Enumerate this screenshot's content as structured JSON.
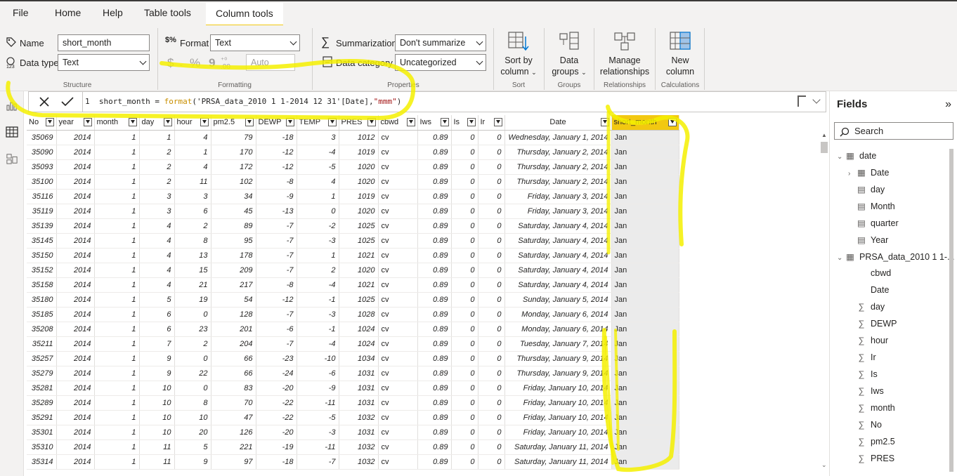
{
  "menu": {
    "file": "File",
    "home": "Home",
    "help": "Help",
    "table_tools": "Table tools",
    "column_tools": "Column tools"
  },
  "ribbon": {
    "name_label": "Name",
    "name_value": "short_month",
    "datatype_label": "Data type",
    "datatype_value": "Text",
    "structure_label": "Structure",
    "format_label": "Format",
    "format_value": "Text",
    "currency_symbol": "$",
    "percent_symbol": "%",
    "comma_symbol": "9",
    "decimal_value": "Auto",
    "formatting_label": "Formatting",
    "summarization_label": "Summarization",
    "summarization_value": "Don't summarize",
    "datacategory_label": "Data category",
    "datacategory_value": "Uncategorized",
    "properties_label": "Properties",
    "sortby_line1": "Sort by",
    "sortby_line2": "column",
    "sort_label": "Sort",
    "datagroups_line1": "Data",
    "datagroups_line2": "groups",
    "groups_label": "Groups",
    "manage_line1": "Manage",
    "manage_line2": "relationships",
    "relationships_label": "Relationships",
    "newcol_line1": "New",
    "newcol_line2": "column",
    "calculations_label": "Calculations"
  },
  "formula": {
    "line_no": "1",
    "prefix": "short_month = ",
    "fn": "format",
    "arg": "('PRSA_data_2010 1 1-2014 12 31'[Date],",
    "str": "\"mmm\"",
    "suffix": ")"
  },
  "table": {
    "headers": [
      "No",
      "year",
      "month",
      "day",
      "hour",
      "pm2.5",
      "DEWP",
      "TEMP",
      "PRES",
      "cbwd",
      "Iws",
      "Is",
      "Ir",
      "Date",
      "short_month"
    ],
    "rows": [
      [
        "35069",
        "2014",
        "1",
        "1",
        "4",
        "79",
        "-18",
        "3",
        "1012",
        "cv",
        "0.89",
        "0",
        "0",
        "Wednesday, January 1, 2014",
        "Jan"
      ],
      [
        "35090",
        "2014",
        "1",
        "2",
        "1",
        "170",
        "-12",
        "-4",
        "1019",
        "cv",
        "0.89",
        "0",
        "0",
        "Thursday, January 2, 2014",
        "Jan"
      ],
      [
        "35093",
        "2014",
        "1",
        "2",
        "4",
        "172",
        "-12",
        "-5",
        "1020",
        "cv",
        "0.89",
        "0",
        "0",
        "Thursday, January 2, 2014",
        "Jan"
      ],
      [
        "35100",
        "2014",
        "1",
        "2",
        "11",
        "102",
        "-8",
        "4",
        "1020",
        "cv",
        "0.89",
        "0",
        "0",
        "Thursday, January 2, 2014",
        "Jan"
      ],
      [
        "35116",
        "2014",
        "1",
        "3",
        "3",
        "34",
        "-9",
        "1",
        "1019",
        "cv",
        "0.89",
        "0",
        "0",
        "Friday, January 3, 2014",
        "Jan"
      ],
      [
        "35119",
        "2014",
        "1",
        "3",
        "6",
        "45",
        "-13",
        "0",
        "1020",
        "cv",
        "0.89",
        "0",
        "0",
        "Friday, January 3, 2014",
        "Jan"
      ],
      [
        "35139",
        "2014",
        "1",
        "4",
        "2",
        "89",
        "-7",
        "-2",
        "1025",
        "cv",
        "0.89",
        "0",
        "0",
        "Saturday, January 4, 2014",
        "Jan"
      ],
      [
        "35145",
        "2014",
        "1",
        "4",
        "8",
        "95",
        "-7",
        "-3",
        "1025",
        "cv",
        "0.89",
        "0",
        "0",
        "Saturday, January 4, 2014",
        "Jan"
      ],
      [
        "35150",
        "2014",
        "1",
        "4",
        "13",
        "178",
        "-7",
        "1",
        "1021",
        "cv",
        "0.89",
        "0",
        "0",
        "Saturday, January 4, 2014",
        "Jan"
      ],
      [
        "35152",
        "2014",
        "1",
        "4",
        "15",
        "209",
        "-7",
        "2",
        "1020",
        "cv",
        "0.89",
        "0",
        "0",
        "Saturday, January 4, 2014",
        "Jan"
      ],
      [
        "35158",
        "2014",
        "1",
        "4",
        "21",
        "217",
        "-8",
        "-4",
        "1021",
        "cv",
        "0.89",
        "0",
        "0",
        "Saturday, January 4, 2014",
        "Jan"
      ],
      [
        "35180",
        "2014",
        "1",
        "5",
        "19",
        "54",
        "-12",
        "-1",
        "1025",
        "cv",
        "0.89",
        "0",
        "0",
        "Sunday, January 5, 2014",
        "Jan"
      ],
      [
        "35185",
        "2014",
        "1",
        "6",
        "0",
        "128",
        "-7",
        "-3",
        "1028",
        "cv",
        "0.89",
        "0",
        "0",
        "Monday, January 6, 2014",
        "Jan"
      ],
      [
        "35208",
        "2014",
        "1",
        "6",
        "23",
        "201",
        "-6",
        "-1",
        "1024",
        "cv",
        "0.89",
        "0",
        "0",
        "Monday, January 6, 2014",
        "Jan"
      ],
      [
        "35211",
        "2014",
        "1",
        "7",
        "2",
        "204",
        "-7",
        "-4",
        "1024",
        "cv",
        "0.89",
        "0",
        "0",
        "Tuesday, January 7, 2014",
        "Jan"
      ],
      [
        "35257",
        "2014",
        "1",
        "9",
        "0",
        "66",
        "-23",
        "-10",
        "1034",
        "cv",
        "0.89",
        "0",
        "0",
        "Thursday, January 9, 2014",
        "Jan"
      ],
      [
        "35279",
        "2014",
        "1",
        "9",
        "22",
        "66",
        "-24",
        "-6",
        "1031",
        "cv",
        "0.89",
        "0",
        "0",
        "Thursday, January 9, 2014",
        "Jan"
      ],
      [
        "35281",
        "2014",
        "1",
        "10",
        "0",
        "83",
        "-20",
        "-9",
        "1031",
        "cv",
        "0.89",
        "0",
        "0",
        "Friday, January 10, 2014",
        "Jan"
      ],
      [
        "35289",
        "2014",
        "1",
        "10",
        "8",
        "70",
        "-22",
        "-11",
        "1031",
        "cv",
        "0.89",
        "0",
        "0",
        "Friday, January 10, 2014",
        "Jan"
      ],
      [
        "35291",
        "2014",
        "1",
        "10",
        "10",
        "47",
        "-22",
        "-5",
        "1032",
        "cv",
        "0.89",
        "0",
        "0",
        "Friday, January 10, 2014",
        "Jan"
      ],
      [
        "35301",
        "2014",
        "1",
        "10",
        "20",
        "126",
        "-20",
        "-3",
        "1031",
        "cv",
        "0.89",
        "0",
        "0",
        "Friday, January 10, 2014",
        "Jan"
      ],
      [
        "35310",
        "2014",
        "1",
        "11",
        "5",
        "221",
        "-19",
        "-11",
        "1032",
        "cv",
        "0.89",
        "0",
        "0",
        "Saturday, January 11, 2014",
        "Jan"
      ],
      [
        "35314",
        "2014",
        "1",
        "11",
        "9",
        "97",
        "-18",
        "-7",
        "1032",
        "cv",
        "0.89",
        "0",
        "0",
        "Saturday, January 11, 2014",
        "Jan"
      ]
    ]
  },
  "fields": {
    "title": "Fields",
    "search_placeholder": "Search",
    "items": [
      {
        "label": "date",
        "icon": "table-icon"
      },
      {
        "label": "Date",
        "icon": "calendar-icon"
      },
      {
        "label": "day",
        "icon": "calc-column-icon"
      },
      {
        "label": "Month",
        "icon": "calc-column-icon"
      },
      {
        "label": "quarter",
        "icon": "calc-column-icon"
      },
      {
        "label": "Year",
        "icon": "calc-column-icon"
      },
      {
        "label": "PRSA_data_2010 1 1-...",
        "icon": "table-icon"
      },
      {
        "label": "cbwd",
        "icon": "none"
      },
      {
        "label": "Date",
        "icon": "none"
      },
      {
        "label": "day",
        "icon": "sigma-icon"
      },
      {
        "label": "DEWP",
        "icon": "sigma-icon"
      },
      {
        "label": "hour",
        "icon": "sigma-icon"
      },
      {
        "label": "Ir",
        "icon": "sigma-icon"
      },
      {
        "label": "Is",
        "icon": "sigma-icon"
      },
      {
        "label": "Iws",
        "icon": "sigma-icon"
      },
      {
        "label": "month",
        "icon": "sigma-icon"
      },
      {
        "label": "No",
        "icon": "sigma-icon"
      },
      {
        "label": "pm2.5",
        "icon": "sigma-icon"
      },
      {
        "label": "PRES",
        "icon": "sigma-icon"
      }
    ]
  },
  "colors": {
    "accent": "#f2c811",
    "highlight_marker": "#f5f000",
    "ribbon_bg": "#f3f2f1"
  }
}
